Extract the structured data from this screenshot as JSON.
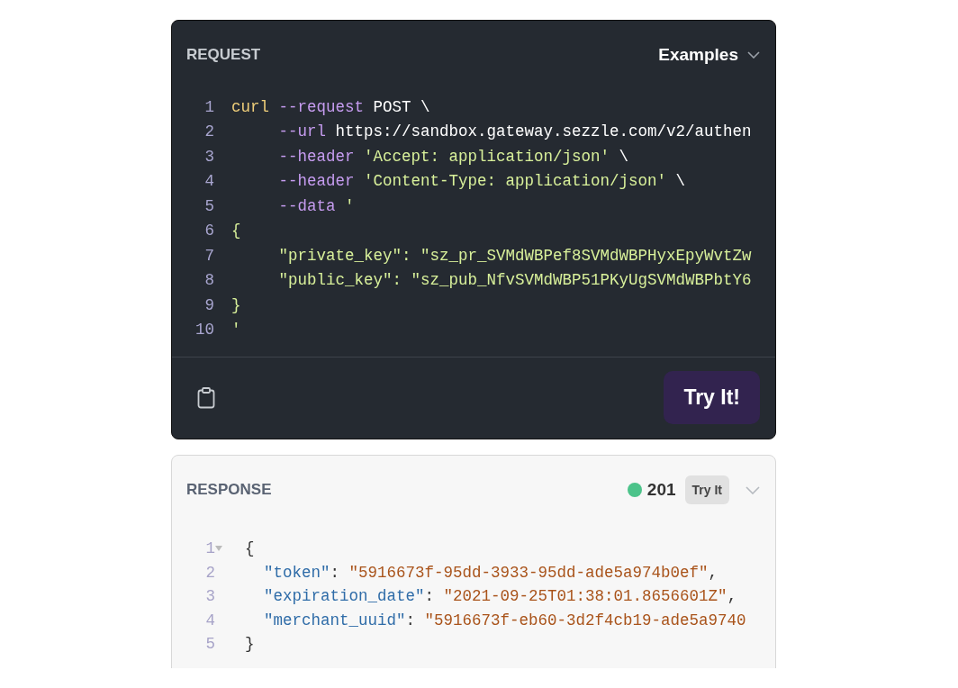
{
  "request": {
    "title": "REQUEST",
    "examples_label": "Examples",
    "try_button": "Try It!",
    "lines": [
      {
        "number": "1",
        "tokens": [
          {
            "kind": "command",
            "text": "curl"
          },
          {
            "kind": "flag",
            "text": " --request"
          },
          {
            "kind": "plain",
            "text": " POST \\"
          }
        ]
      },
      {
        "number": "2",
        "tokens": [
          {
            "kind": "flag",
            "text": "     --url"
          },
          {
            "kind": "plain",
            "text": " https://sandbox.gateway.sezzle.com/v2/authen"
          }
        ]
      },
      {
        "number": "3",
        "tokens": [
          {
            "kind": "flag",
            "text": "     --header"
          },
          {
            "kind": "string",
            "text": " 'Accept: application/json'"
          },
          {
            "kind": "plain",
            "text": " \\"
          }
        ]
      },
      {
        "number": "4",
        "tokens": [
          {
            "kind": "flag",
            "text": "     --header"
          },
          {
            "kind": "string",
            "text": " 'Content-Type: application/json'"
          },
          {
            "kind": "plain",
            "text": " \\"
          }
        ]
      },
      {
        "number": "5",
        "tokens": [
          {
            "kind": "flag",
            "text": "     --data"
          },
          {
            "kind": "string",
            "text": " '"
          }
        ]
      },
      {
        "number": "6",
        "tokens": [
          {
            "kind": "string",
            "text": "{"
          }
        ]
      },
      {
        "number": "7",
        "tokens": [
          {
            "kind": "string",
            "text": "     \"private_key\": \"sz_pr_SVMdWBPef8SVMdWBPHyxEpyWvtZw"
          }
        ]
      },
      {
        "number": "8",
        "tokens": [
          {
            "kind": "string",
            "text": "     \"public_key\": \"sz_pub_NfvSVMdWBP51PKyUgSVMdWBPbtY6"
          }
        ]
      },
      {
        "number": "9",
        "tokens": [
          {
            "kind": "string",
            "text": "}"
          }
        ]
      },
      {
        "number": "10",
        "tokens": [
          {
            "kind": "string",
            "text": "'"
          }
        ]
      }
    ]
  },
  "response": {
    "title": "RESPONSE",
    "status": {
      "code": "201",
      "color": "#4cc38a"
    },
    "try_badge": "Try It",
    "lines": [
      {
        "number": "1",
        "fold": true,
        "tokens": [
          {
            "kind": "punct",
            "text": "{"
          }
        ]
      },
      {
        "number": "2",
        "fold": false,
        "tokens": [
          {
            "kind": "key",
            "text": "  \"token\""
          },
          {
            "kind": "punct",
            "text": ": "
          },
          {
            "kind": "value",
            "text": "\"5916673f-95dd-3933-95dd-ade5a974b0ef\""
          },
          {
            "kind": "punct",
            "text": ","
          }
        ]
      },
      {
        "number": "3",
        "fold": false,
        "tokens": [
          {
            "kind": "key",
            "text": "  \"expiration_date\""
          },
          {
            "kind": "punct",
            "text": ": "
          },
          {
            "kind": "value",
            "text": "\"2021-09-25T01:38:01.8656601Z\""
          },
          {
            "kind": "punct",
            "text": ","
          }
        ]
      },
      {
        "number": "4",
        "fold": false,
        "tokens": [
          {
            "kind": "key",
            "text": "  \"merchant_uuid\""
          },
          {
            "kind": "punct",
            "text": ": "
          },
          {
            "kind": "value",
            "text": "\"5916673f-eb60-3d2f4cb19-ade5a9740"
          }
        ]
      },
      {
        "number": "5",
        "fold": false,
        "tokens": [
          {
            "kind": "punct",
            "text": "}"
          }
        ]
      }
    ]
  }
}
